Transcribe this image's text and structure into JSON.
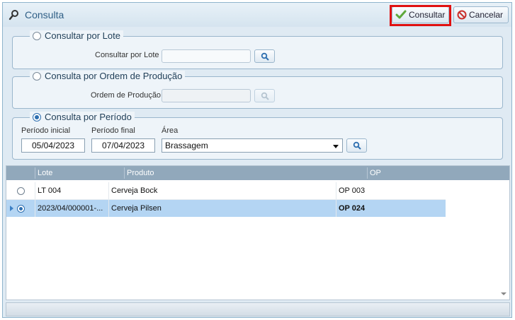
{
  "dialog": {
    "title": "Consulta"
  },
  "toolbar": {
    "consultar_label": "Consultar",
    "cancelar_label": "Cancelar"
  },
  "lote_group": {
    "legend": "Consultar por Lote",
    "field_label": "Consultar por Lote",
    "value": "",
    "selected": false
  },
  "ordem_group": {
    "legend": "Consulta por Ordem de Produção",
    "field_label": "Ordem de Produção",
    "value": "",
    "selected": false
  },
  "periodo_group": {
    "legend": "Consulta por Período",
    "selected": true,
    "inicial_label": "Período inicial",
    "inicial_value": "05/04/2023",
    "final_label": "Período final",
    "final_value": "07/04/2023",
    "area_label": "Área",
    "area_value": "Brassagem"
  },
  "grid": {
    "columns": [
      "Lote",
      "Produto",
      "OP"
    ],
    "rows": [
      {
        "lote": "LT 004",
        "produto": "Cerveja Bock",
        "op": "OP 003",
        "selected": false
      },
      {
        "lote": "2023/04/000001-...",
        "produto": "Cerveja Pilsen",
        "op": "OP 024",
        "selected": true
      }
    ]
  },
  "colors": {
    "accent": "#2e6fb0",
    "selected_row": "#b4d5f3",
    "header": "#91a8bb",
    "highlight_border": "#e01010"
  },
  "icons": {
    "title": "search-icon",
    "consultar": "check-icon",
    "cancelar": "cancel-icon",
    "field_search": "search-icon"
  }
}
